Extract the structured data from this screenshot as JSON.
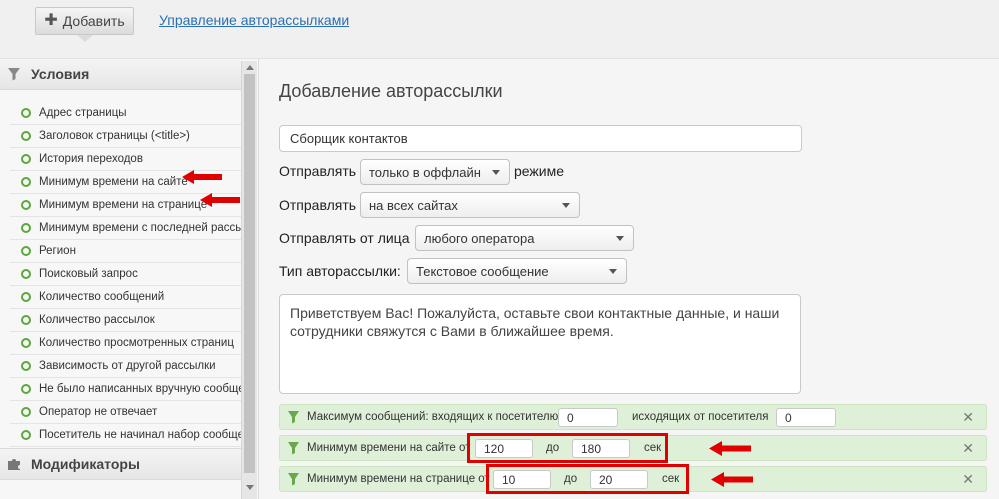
{
  "toolbar": {
    "add_label": "Добавить",
    "manage_link": "Управление авторассылками"
  },
  "sidebar": {
    "conditions_title": "Условия",
    "modifiers_title": "Модификаторы",
    "items": [
      {
        "label": "Адрес страницы"
      },
      {
        "label": "Заголовок страницы (<title>)"
      },
      {
        "label": "История переходов"
      },
      {
        "label": "Минимум времени на сайте"
      },
      {
        "label": "Минимум времени на странице"
      },
      {
        "label": "Минимум времени с последней рассылки"
      },
      {
        "label": "Регион"
      },
      {
        "label": "Поисковый запрос"
      },
      {
        "label": "Количество сообщений"
      },
      {
        "label": "Количество рассылок"
      },
      {
        "label": "Количество просмотренных страниц"
      },
      {
        "label": "Зависимость от другой рассылки"
      },
      {
        "label": "Не было написанных вручную сообщений"
      },
      {
        "label": "Оператор не отвечает"
      },
      {
        "label": "Посетитель не начинал набор сообщения"
      }
    ]
  },
  "main": {
    "title": "Добавление авторассылки",
    "name_value": "Сборщик контактов",
    "send_label": "Отправлять",
    "send_mode": "только в оффлайн",
    "mode_suffix": "режиме",
    "send_sites_label": "Отправлять",
    "send_sites": "на всех сайтах",
    "send_from_label": "Отправлять от лица",
    "send_from": "любого оператора",
    "type_label": "Тип авторассылки:",
    "type_value": "Текстовое сообщение",
    "message": "Приветствуем Вас! Пожалуйста, оставьте свои контактные данные, и наши сотрудники свяжутся с Вами в ближайшее время.",
    "rules": {
      "max_messages": {
        "label": "Максимум сообщений: входящих к посетителю",
        "incoming": "0",
        "outgoing_label": "исходящих от посетителя",
        "outgoing": "0"
      },
      "min_site": {
        "label": "Минимум времени на сайте от",
        "from": "120",
        "to_label": "до",
        "to": "180",
        "unit": "сек"
      },
      "min_page": {
        "label": "Минимум времени на странице от",
        "from": "10",
        "to_label": "до",
        "to": "20",
        "unit": "сек"
      }
    }
  },
  "colors": {
    "accent_link": "#2a6fb5",
    "rule_bg": "#dff0d8",
    "highlight": "#e00000",
    "dot": "#5aa83a"
  },
  "icons": [
    "plus-icon",
    "filter-icon",
    "puzzle-icon",
    "close-icon",
    "arrow-icon"
  ]
}
